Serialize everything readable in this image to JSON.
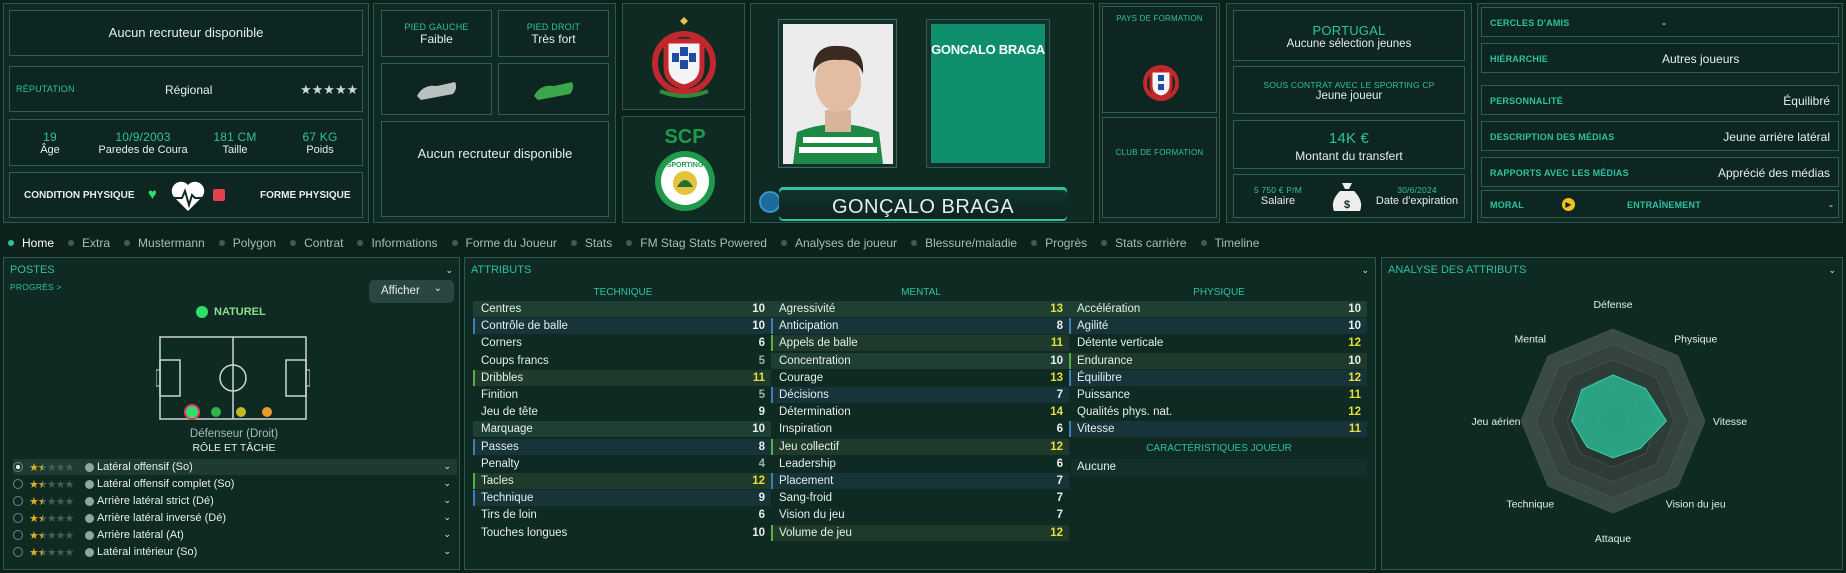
{
  "header": {
    "recruiter_1": "Aucun recruteur disponible",
    "reputation_label": "RÉPUTATION",
    "reputation_value": "Régional",
    "reputation_stars": "★★★★★",
    "age_value": "19",
    "age_label": "Âge",
    "dob_value": "10/9/2003",
    "dob_label": "Paredes de Coura",
    "height_value": "181 CM",
    "height_label": "Taille",
    "weight_value": "67 KG",
    "weight_label": "Poids",
    "condition_label": "CONDITION PHYSIQUE",
    "form_label": "FORME PHYSIQUE",
    "left_foot_label": "PIED GAUCHE",
    "left_foot_value": "Faible",
    "right_foot_label": "PIED DROIT",
    "right_foot_value": "Très fort",
    "recruiter_2": "Aucun recruteur disponible",
    "name_card": "GONCALO BRAGA",
    "player_name": "GONÇALO BRAGA",
    "club_initials": "SCP",
    "club_badge_text": "SPORTING",
    "formation_country_label": "PAYS DE FORMATION",
    "formation_club_label": "CLUB DE FORMATION",
    "nation": "PORTUGAL",
    "nation_sub": "Aucune sélection jeunes",
    "contract_label": "SOUS CONTRAT AVEC LE SPORTING CP",
    "contract_value": "Jeune joueur",
    "transfer_value": "14K €",
    "transfer_label": "Montant du transfert",
    "salary_value": "5 750 € P/M",
    "salary_label": "Salaire",
    "expiry_value": "30/6/2024",
    "expiry_label": "Date d'expiration"
  },
  "personality": [
    {
      "label": "CERCLES D'AMIS",
      "value": "-"
    },
    {
      "label": "HIÉRARCHIE",
      "value": "Autres joueurs"
    },
    {
      "label": "PERSONNALITÉ",
      "value": "Équilibré"
    },
    {
      "label": "DESCRIPTION DES MÉDIAS",
      "value": "Jeune arrière latéral"
    },
    {
      "label": "RAPPORTS AVEC LES MÉDIAS",
      "value": "Apprécié des médias"
    }
  ],
  "morale": {
    "label": "MORAL",
    "training_label": "ENTRAÎNEMENT",
    "training_value": "-"
  },
  "tabs": [
    "Home",
    "Extra",
    "Mustermann",
    "Polygon",
    "Contrat",
    "Informations",
    "Forme du Joueur",
    "Stats",
    "FM Stag Stats Powered",
    "Analyses de joueur",
    "Blessure/maladie",
    "Progrès",
    "Stats carrière",
    "Timeline"
  ],
  "positions": {
    "title": "POSTES",
    "progress_link": "PROGRÈS >",
    "show_button": "Afficher",
    "natural": "NATUREL",
    "position_name": "Défenseur (Droit)",
    "role_title": "RÔLE ET TÂCHE",
    "roles": [
      {
        "name": "Latéral offensif (So)",
        "stars": 1.5
      },
      {
        "name": "Latéral offensif complet (So)",
        "stars": 1.5
      },
      {
        "name": "Arrière latéral strict (Dé)",
        "stars": 1.5
      },
      {
        "name": "Arrière latéral inversé (Dé)",
        "stars": 1.5
      },
      {
        "name": "Arrière latéral (At)",
        "stars": 1.5
      },
      {
        "name": "Latéral intérieur (So)",
        "stars": 1.5
      }
    ]
  },
  "attributes": {
    "title": "ATTRIBUTS",
    "technical_title": "TECHNIQUE",
    "mental_title": "MENTAL",
    "physical_title": "PHYSIQUE",
    "traits_title": "CARACTÉRISTIQUES JOUEUR",
    "traits_value": "Aucune",
    "technical": [
      {
        "name": "Centres",
        "value": "10"
      },
      {
        "name": "Contrôle de balle",
        "value": "10"
      },
      {
        "name": "Corners",
        "value": "6"
      },
      {
        "name": "Coups francs",
        "value": "5"
      },
      {
        "name": "Dribbles",
        "value": "11"
      },
      {
        "name": "Finition",
        "value": "5"
      },
      {
        "name": "Jeu de tête",
        "value": "9"
      },
      {
        "name": "Marquage",
        "value": "10"
      },
      {
        "name": "Passes",
        "value": "8"
      },
      {
        "name": "Penalty",
        "value": "4"
      },
      {
        "name": "Tacles",
        "value": "12"
      },
      {
        "name": "Technique",
        "value": "9"
      },
      {
        "name": "Tirs de loin",
        "value": "6"
      },
      {
        "name": "Touches longues",
        "value": "10"
      }
    ],
    "mental": [
      {
        "name": "Agressivité",
        "value": "13"
      },
      {
        "name": "Anticipation",
        "value": "8"
      },
      {
        "name": "Appels de balle",
        "value": "11"
      },
      {
        "name": "Concentration",
        "value": "10"
      },
      {
        "name": "Courage",
        "value": "13"
      },
      {
        "name": "Décisions",
        "value": "7"
      },
      {
        "name": "Détermination",
        "value": "14"
      },
      {
        "name": "Inspiration",
        "value": "6"
      },
      {
        "name": "Jeu collectif",
        "value": "12"
      },
      {
        "name": "Leadership",
        "value": "6"
      },
      {
        "name": "Placement",
        "value": "7"
      },
      {
        "name": "Sang-froid",
        "value": "7"
      },
      {
        "name": "Vision du jeu",
        "value": "7"
      },
      {
        "name": "Volume de jeu",
        "value": "12"
      }
    ],
    "physical": [
      {
        "name": "Accélération",
        "value": "10"
      },
      {
        "name": "Agilité",
        "value": "10"
      },
      {
        "name": "Détente verticale",
        "value": "12"
      },
      {
        "name": "Endurance",
        "value": "10"
      },
      {
        "name": "Équilibre",
        "value": "12"
      },
      {
        "name": "Puissance",
        "value": "11"
      },
      {
        "name": "Qualités phys. nat.",
        "value": "12"
      },
      {
        "name": "Vitesse",
        "value": "11"
      }
    ]
  },
  "analysis": {
    "title": "ANALYSE DES ATTRIBUTS",
    "axes": [
      "Défense",
      "Physique",
      "Vitesse",
      "Vision du jeu",
      "Attaque",
      "Technique",
      "Jeu aérien",
      "Mental"
    ],
    "values": [
      0.5,
      0.5,
      0.58,
      0.42,
      0.4,
      0.4,
      0.45,
      0.48
    ]
  },
  "colors": {
    "accent": "#2fc2a0",
    "background": "#0c211c",
    "highlight_yellow": "#e6df3a"
  }
}
